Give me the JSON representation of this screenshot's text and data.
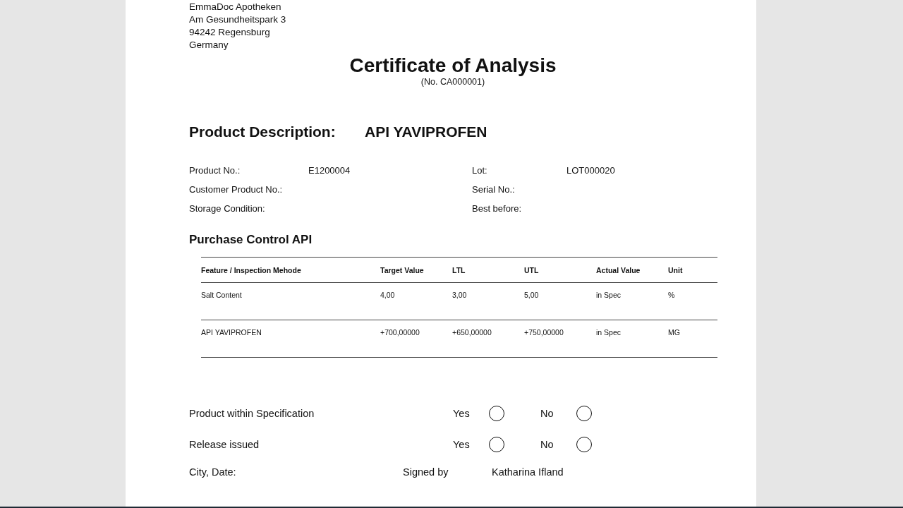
{
  "sender_address": [
    "EmmaDoc Apotheken",
    "Am Gesundheitspark 3",
    "94242 Regensburg",
    "Germany"
  ],
  "title": "Certificate of Analysis",
  "certificate_number": "(No. CA000001)",
  "product_description": {
    "label": "Product Description:",
    "value": "API YAVIPROFEN"
  },
  "fields": [
    {
      "label": "Product No.:",
      "value": "E1200004"
    },
    {
      "label": "Lot:",
      "value": "LOT000020"
    },
    {
      "label": "Customer Product No.:"
    },
    {
      "label": "Serial No.:"
    },
    {
      "label": "Storage Condition:"
    },
    {
      "label": "Best before:"
    }
  ],
  "section_title": "Purchase Control API",
  "table": {
    "columns": [
      "Feature / Inspection Mehode",
      "Target Value",
      "LTL",
      "UTL",
      "Actual Value",
      "Unit"
    ],
    "rows": [
      [
        "Salt Content",
        "4,00",
        "3,00",
        "5,00",
        "in Spec",
        "%"
      ],
      [
        "API YAVIPROFEN",
        "+700,00000",
        "+650,00000",
        "+750,00000",
        "in Spec",
        "MG"
      ]
    ]
  },
  "checks": [
    {
      "label": "Product within Specification",
      "options": [
        "Yes",
        "No"
      ]
    },
    {
      "label": "Release issued",
      "options": [
        "Yes",
        "No"
      ]
    }
  ],
  "signature": {
    "city_date_label": "City, Date:",
    "signed_by_label": "Signed by",
    "signer": "Katharina Ifland"
  }
}
